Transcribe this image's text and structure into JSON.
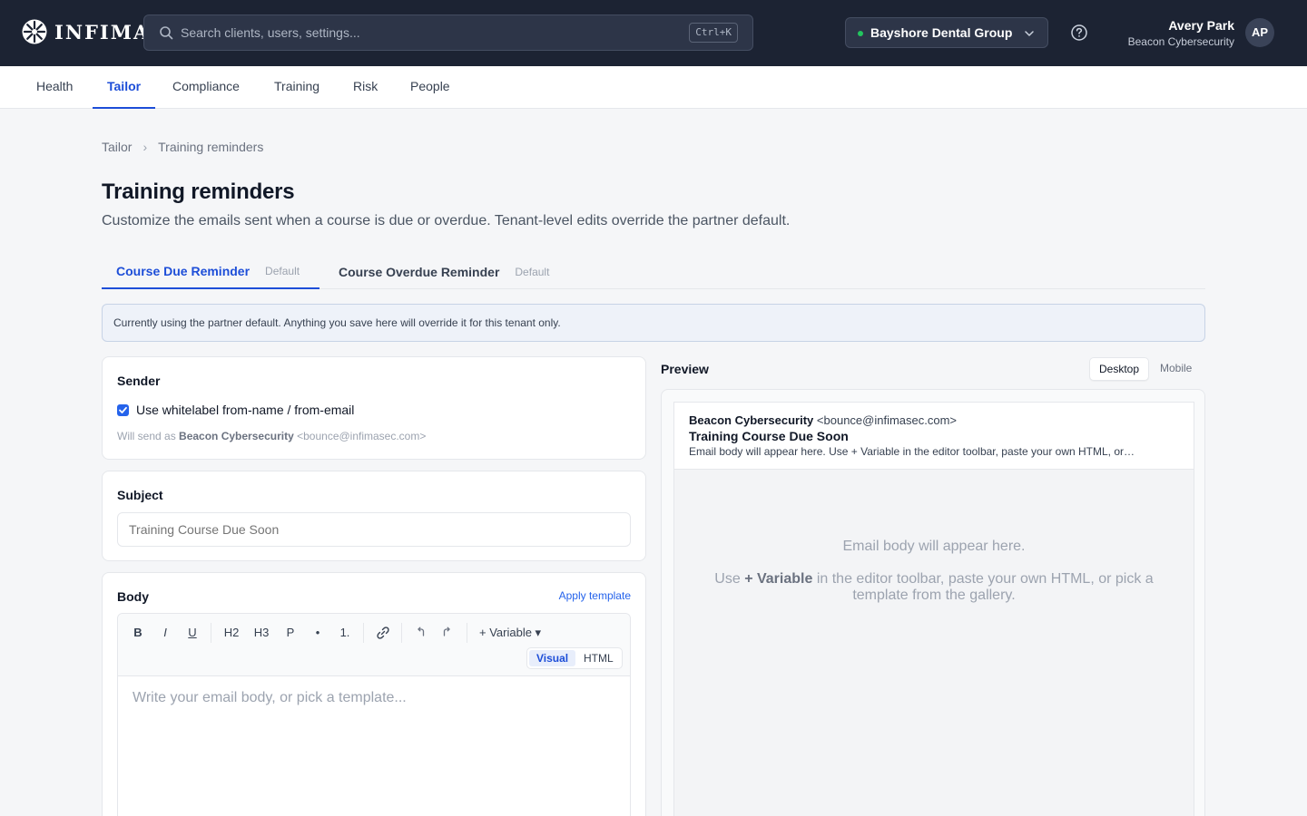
{
  "brand": {
    "name": "INFIMA"
  },
  "search": {
    "placeholder": "Search clients, users, settings...",
    "shortcut": "Ctrl+K"
  },
  "tenant": {
    "name": "Bayshore Dental Group",
    "status_color": "#22c55e"
  },
  "user": {
    "name": "Avery Park",
    "org": "Beacon Cybersecurity",
    "initials": "AP"
  },
  "nav": {
    "items": [
      {
        "label": "Health"
      },
      {
        "label": "Tailor"
      },
      {
        "label": "Compliance"
      },
      {
        "label": "Training"
      },
      {
        "label": "Risk"
      },
      {
        "label": "People"
      }
    ],
    "active": "Tailor"
  },
  "breadcrumb": {
    "parent": "Tailor",
    "separator": "›",
    "current": "Training reminders"
  },
  "page": {
    "title": "Training reminders",
    "description": "Customize the emails sent when a course is due or overdue. Tenant-level edits override the partner default."
  },
  "tabs": [
    {
      "label": "Course Due Reminder",
      "badge": "Default",
      "active": true
    },
    {
      "label": "Course Overdue Reminder",
      "badge": "Default",
      "active": false
    }
  ],
  "notice": "Currently using the partner default. Anything you save here will override it for this tenant only.",
  "sender": {
    "title": "Sender",
    "checkbox_label": "Use whitelabel from-name / from-email",
    "checked": true,
    "note_prefix": "Will send as",
    "from_name": "Beacon Cybersecurity",
    "from_email": "<bounce@infimasec.com>"
  },
  "subject": {
    "title": "Subject",
    "placeholder": "Training Course Due Soon"
  },
  "body": {
    "title": "Body",
    "apply_template": "Apply template",
    "toolbar": {
      "bold": "B",
      "italic": "I",
      "underline": "U",
      "h2": "H2",
      "h3": "H3",
      "p": "P",
      "bullet": "•",
      "numbered": "1.",
      "variable": "+ Variable ▾"
    },
    "modes": {
      "visual": "Visual",
      "html": "HTML",
      "active": "Visual"
    },
    "placeholder": "Write your email body, or pick a template..."
  },
  "preview": {
    "title": "Preview",
    "devices": {
      "desktop": "Desktop",
      "mobile": "Mobile",
      "active": "Desktop"
    },
    "from_name": "Beacon Cybersecurity",
    "from_email": "<bounce@infimasec.com>",
    "subject": "Training Course Due Soon",
    "snippet": "Email body will appear here. Use + Variable in the editor toolbar, paste your own HTML, or…",
    "empty_line1": "Email body will appear here.",
    "empty_use": "Use",
    "empty_variable": "+ Variable",
    "empty_rest": "in the editor toolbar, paste your own HTML, or pick a template from the gallery."
  },
  "colors": {
    "accent": "#1d4ed8",
    "topbar": "#1c2333",
    "link": "#2563eb"
  }
}
